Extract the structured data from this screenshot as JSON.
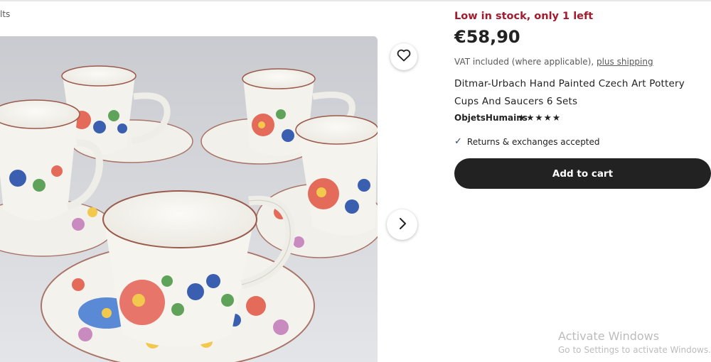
{
  "breadcrumb": {
    "fragment": "lts"
  },
  "product": {
    "stock_notice": "Low in stock, only 1 left",
    "price": "€58,90",
    "vat_text": "VAT included (where applicable), ",
    "shipping_link": "plus shipping",
    "title": "Ditmar-Urbach Hand Painted Czech Art Pottery Cups And Saucers 6 Sets",
    "shop_name": "ObjetsHumains",
    "rating_stars": "★★★★★",
    "rating_value": 5,
    "returns_text": "Returns & exchanges accepted",
    "add_to_cart_label": "Add to cart"
  },
  "gallery": {
    "favorite_icon": "heart-icon",
    "next_icon": "chevron-right-icon",
    "image_subject": "hand painted floral cups and saucers"
  },
  "watermark": {
    "title": "Activate Windows",
    "subtitle": "Go to Settings to activate Windows."
  },
  "colors": {
    "stock_red": "#a61a2e",
    "button_dark": "#222222",
    "check_blue": "#2f466c"
  }
}
